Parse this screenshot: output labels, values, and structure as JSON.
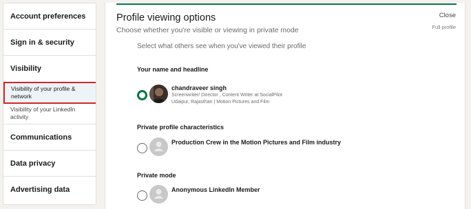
{
  "sidebar": {
    "items": [
      {
        "label": "Account preferences"
      },
      {
        "label": "Sign in & security"
      },
      {
        "label": "Visibility"
      },
      {
        "label": "Communications"
      },
      {
        "label": "Data privacy"
      },
      {
        "label": "Advertising data"
      }
    ],
    "visibility_sub": [
      {
        "label": "Visibility of your profile & network",
        "selected": true
      },
      {
        "label": "Visibility of your LinkedIn activity",
        "selected": false
      }
    ]
  },
  "main": {
    "title": "Profile viewing options",
    "subtitle": "Choose whether you're visible or viewing in private mode",
    "close_label": "Close",
    "full_profile_label": "Full profile",
    "instruction": "Select what others see when you've viewed their profile",
    "options": [
      {
        "section": "Your name and headline",
        "name": "chandraveer singh",
        "line1": "Screenwriter/ Director , Content Writer at SocialPilot",
        "line2": "Udaipur, Rajasthan | Motion Pictures and Film",
        "selected": true
      },
      {
        "section": "Private profile characteristics",
        "name": "Production Crew in the Motion Pictures and Film industry",
        "selected": false
      },
      {
        "section": "Private mode",
        "name": "Anonymous LinkedIn Member",
        "selected": false
      }
    ]
  },
  "colors": {
    "accent_green": "#057642",
    "highlight_red": "#d1232a",
    "selected_bg": "#eef3f8"
  }
}
